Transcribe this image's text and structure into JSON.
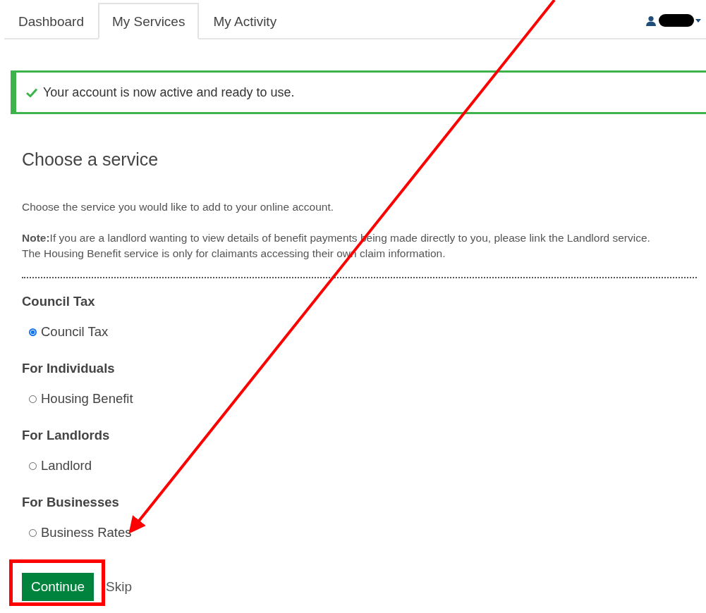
{
  "tabs": [
    {
      "label": "Dashboard",
      "selected": false
    },
    {
      "label": "My Services",
      "selected": true
    },
    {
      "label": "My Activity",
      "selected": false
    }
  ],
  "alert": {
    "message": "Your account is now active and ready to use."
  },
  "title": "Choose a service",
  "intro": "Choose the service you would like to add to your online account.",
  "note": "**Note:**If you are a landlord wanting to view details of benefit payments being made directly to you, please link the Landlord service. The Housing Benefit service is only for claimants accessing their own claim information.",
  "groups": [
    {
      "heading": "Council Tax",
      "options": [
        {
          "label": "Council Tax",
          "selected": true
        }
      ]
    },
    {
      "heading": "For Individuals",
      "options": [
        {
          "label": "Housing Benefit",
          "selected": false
        }
      ]
    },
    {
      "heading": "For Landlords",
      "options": [
        {
          "label": "Landlord",
          "selected": false
        }
      ]
    },
    {
      "heading": "For Businesses",
      "options": [
        {
          "label": "Business Rates",
          "selected": false
        }
      ]
    }
  ],
  "buttons": {
    "primary": "Continue",
    "secondary": "Skip"
  }
}
